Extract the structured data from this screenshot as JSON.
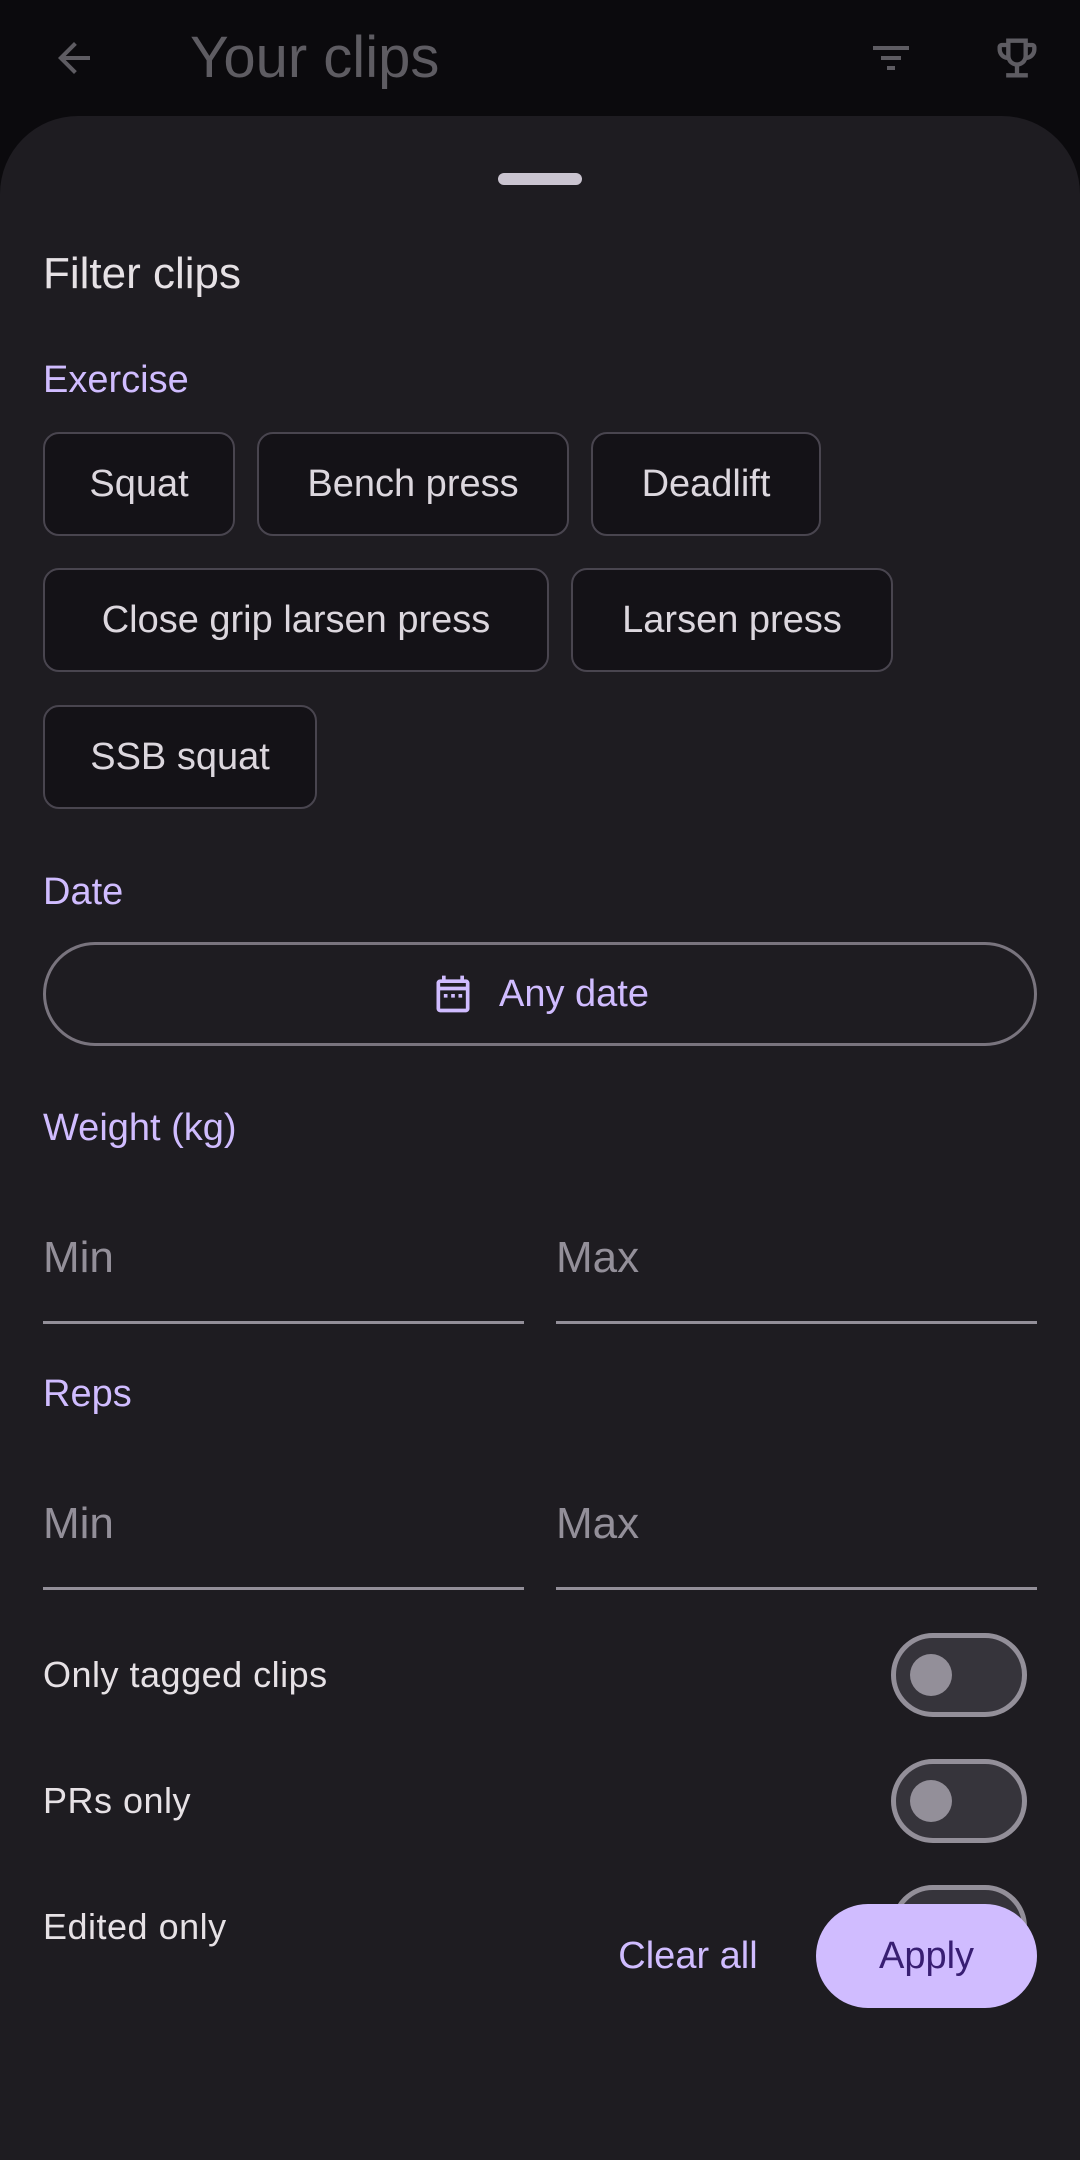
{
  "app_bar": {
    "title": "Your clips",
    "back_icon": "arrow-back-icon",
    "filter_icon": "filter-list-icon",
    "trophy_icon": "trophy-icon"
  },
  "sheet": {
    "title": "Filter clips",
    "exercise": {
      "label": "Exercise",
      "chips": [
        "Squat",
        "Bench press",
        "Deadlift",
        "Close grip larsen press",
        "Larsen press",
        "SSB squat"
      ]
    },
    "date": {
      "label": "Date",
      "button_label": "Any date",
      "icon": "calendar-icon"
    },
    "weight": {
      "label": "Weight (kg)",
      "min_placeholder": "Min",
      "max_placeholder": "Max"
    },
    "reps": {
      "label": "Reps",
      "min_placeholder": "Min",
      "max_placeholder": "Max"
    },
    "toggles": [
      {
        "label": "Only tagged clips",
        "on": false
      },
      {
        "label": "PRs only",
        "on": false
      },
      {
        "label": "Edited only",
        "on": false
      }
    ],
    "actions": {
      "clear_label": "Clear all",
      "apply_label": "Apply"
    }
  },
  "colors": {
    "accent": "#d0bcff",
    "sheet_bg": "#1e1c21",
    "on_accent": "#381e72"
  }
}
